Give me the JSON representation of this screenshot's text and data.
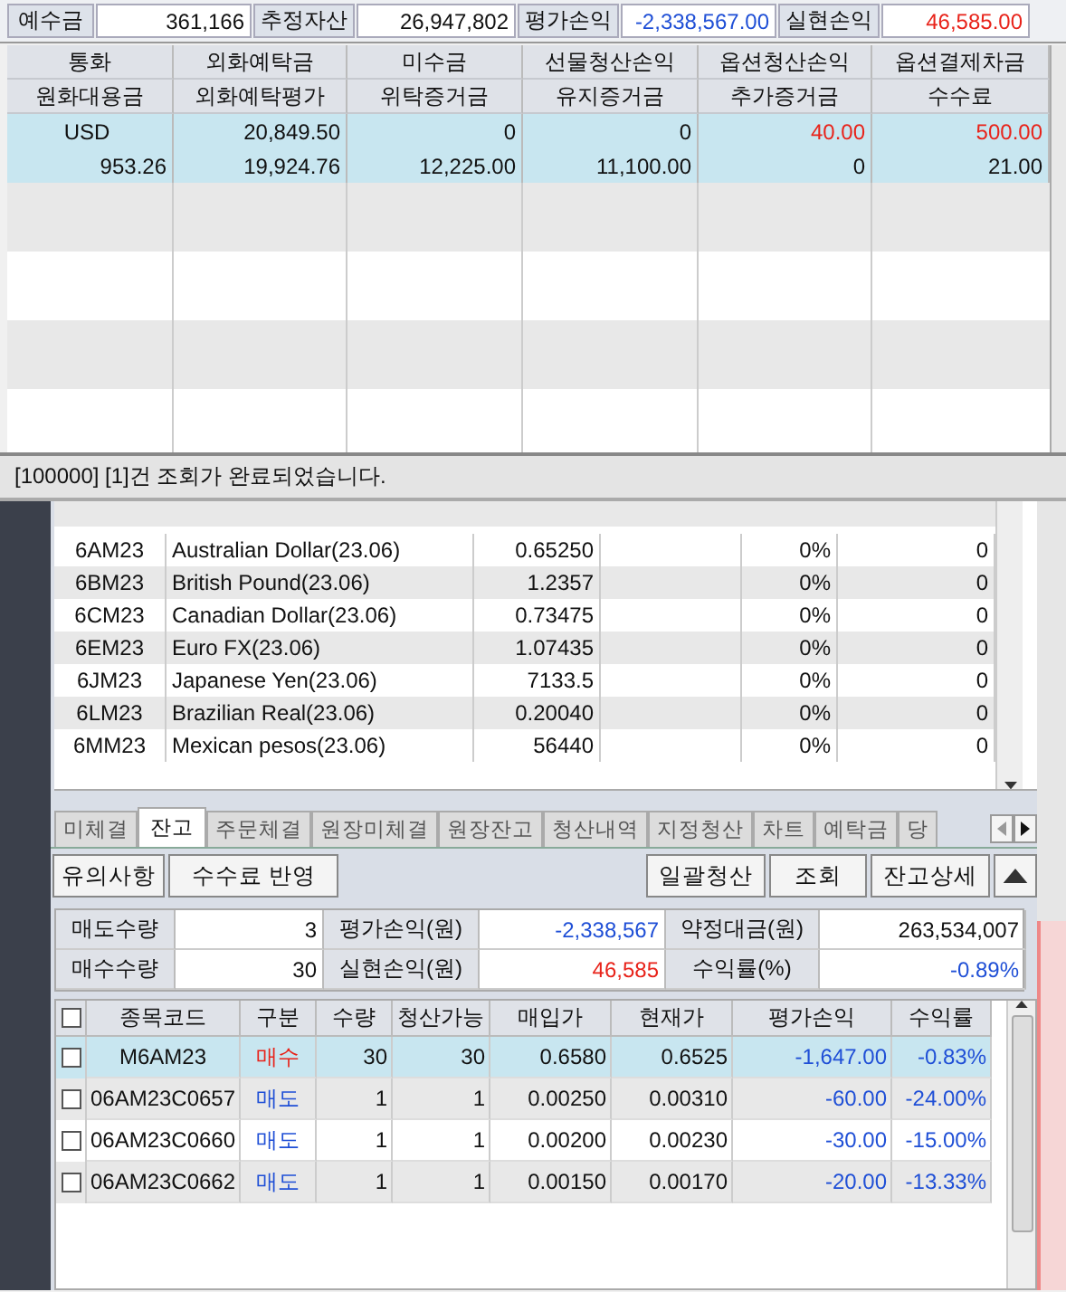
{
  "summary_bar": [
    {
      "label": "예수금",
      "value": "361,166",
      "color": "#111111"
    },
    {
      "label": "추정자산",
      "value": "26,947,802",
      "color": "#111111"
    },
    {
      "label": "평가손익",
      "value": "-2,338,567.00",
      "color": "#1f4fd6"
    },
    {
      "label": "실현손익",
      "value": "46,585.00",
      "color": "#e8231a"
    }
  ],
  "deposit_grid": {
    "header_rows": [
      [
        "통화",
        "외화예탁금",
        "미수금",
        "선물청산손익",
        "옵션청산손익",
        "옵션결제차금"
      ],
      [
        "원화대용금",
        "외화예탁평가",
        "위탁증거금",
        "유지증거금",
        "추가증거금",
        "수수료"
      ]
    ],
    "records": [
      {
        "selected": true,
        "lines": [
          [
            {
              "text": "USD",
              "color": "#111111"
            },
            {
              "text": "20,849.50",
              "color": "#111111"
            },
            {
              "text": "0",
              "color": "#111111"
            },
            {
              "text": "0",
              "color": "#111111"
            },
            {
              "text": "40.00",
              "color": "#e8231a"
            },
            {
              "text": "500.00",
              "color": "#e8231a"
            }
          ],
          [
            {
              "text": "953.26",
              "color": "#111111"
            },
            {
              "text": "19,924.76",
              "color": "#111111"
            },
            {
              "text": "12,225.00",
              "color": "#111111"
            },
            {
              "text": "11,100.00",
              "color": "#111111"
            },
            {
              "text": "0",
              "color": "#111111"
            },
            {
              "text": "21.00",
              "color": "#111111"
            }
          ]
        ]
      }
    ]
  },
  "status_message": "[100000] [1]건 조회가 완료되었습니다.",
  "instrument_list": [
    {
      "code": "6AM23",
      "name": "Australian Dollar(23.06)",
      "price": "0.65250",
      "change": "0%",
      "quantity": "0"
    },
    {
      "code": "6BM23",
      "name": "British Pound(23.06)",
      "price": "1.2357",
      "change": "0%",
      "quantity": "0"
    },
    {
      "code": "6CM23",
      "name": "Canadian Dollar(23.06)",
      "price": "0.73475",
      "change": "0%",
      "quantity": "0"
    },
    {
      "code": "6EM23",
      "name": "Euro FX(23.06)",
      "price": "1.07435",
      "change": "0%",
      "quantity": "0"
    },
    {
      "code": "6JM23",
      "name": "Japanese Yen(23.06)",
      "price": "7133.5",
      "change": "0%",
      "quantity": "0"
    },
    {
      "code": "6LM23",
      "name": "Brazilian Real(23.06)",
      "price": "0.20040",
      "change": "0%",
      "quantity": "0"
    },
    {
      "code": "6MM23",
      "name": "Mexican pesos(23.06)",
      "price": "56440",
      "change": "0%",
      "quantity": "0"
    }
  ],
  "tabs": [
    {
      "label": "미체결",
      "selected": false
    },
    {
      "label": "잔고",
      "selected": true
    },
    {
      "label": "주문체결",
      "selected": false
    },
    {
      "label": "원장미체결",
      "selected": false
    },
    {
      "label": "원장잔고",
      "selected": false
    },
    {
      "label": "청산내역",
      "selected": false
    },
    {
      "label": "지정청산",
      "selected": false
    },
    {
      "label": "차트",
      "selected": false
    },
    {
      "label": "예탁금",
      "selected": false
    },
    {
      "label": "당",
      "selected": false
    }
  ],
  "buttons_left": [
    "유의사항",
    "수수료 반영"
  ],
  "buttons_right": [
    "일괄청산",
    "조회",
    "잔고상세"
  ],
  "balance_summary": [
    [
      {
        "label": "매도수량",
        "value": "3",
        "color": "#111111"
      },
      {
        "label": "평가손익(원)",
        "value": "-2,338,567",
        "color": "#1f4fd6"
      },
      {
        "label": "약정대금(원)",
        "value": "263,534,007",
        "color": "#111111"
      }
    ],
    [
      {
        "label": "매수수량",
        "value": "30",
        "color": "#111111"
      },
      {
        "label": "실현손익(원)",
        "value": "46,585",
        "color": "#e8231a"
      },
      {
        "label": "수익률(%)",
        "value": "-0.89%",
        "color": "#1f4fd6"
      }
    ]
  ],
  "positions": {
    "select_all_checked": false,
    "columns": [
      "종목코드",
      "구분",
      "수량",
      "청산가능",
      "매입가",
      "현재가",
      "평가손익",
      "수익률"
    ],
    "rows": [
      {
        "checked": false,
        "selected": true,
        "color": "#e8231a",
        "cells": [
          "M6AM23",
          "매수",
          "30",
          "30",
          "0.6580",
          "0.6525",
          "-1,647.00",
          "-0.83%"
        ]
      },
      {
        "checked": false,
        "selected": false,
        "color": "#1f4fd6",
        "cells": [
          "06AM23C0657",
          "매도",
          "1",
          "1",
          "0.00250",
          "0.00310",
          "-60.00",
          "-24.00%"
        ]
      },
      {
        "checked": false,
        "selected": false,
        "color": "#1f4fd6",
        "cells": [
          "06AM23C0660",
          "매도",
          "1",
          "1",
          "0.00200",
          "0.00230",
          "-30.00",
          "-15.00%"
        ]
      },
      {
        "checked": false,
        "selected": false,
        "color": "#1f4fd6",
        "cells": [
          "06AM23C0662",
          "매도",
          "1",
          "1",
          "0.00150",
          "0.00170",
          "-20.00",
          "-13.33%"
        ]
      }
    ]
  }
}
